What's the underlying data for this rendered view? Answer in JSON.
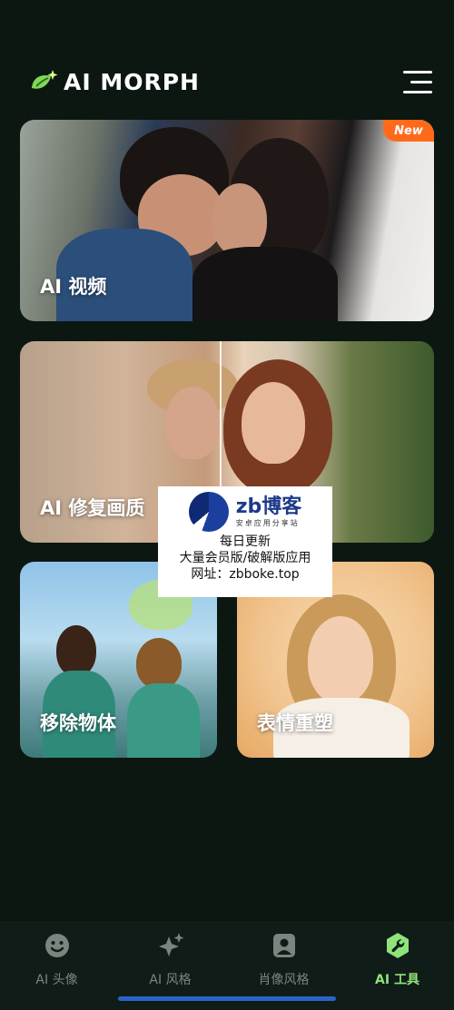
{
  "header": {
    "app_name": "AI MORPH",
    "logo_icon": "leaf-sparkle-logo",
    "menu_icon": "hamburger-menu-icon"
  },
  "cards": [
    {
      "label": "AI 视频",
      "badge": "New"
    },
    {
      "label": "AI 修复画质"
    },
    {
      "label": "移除物体"
    },
    {
      "label": "表情重塑"
    }
  ],
  "watermark": {
    "title": "zb博客",
    "subtitle": "安卓应用分享站",
    "line1": "每日更新",
    "line2": "大量会员版/破解版应用",
    "line3": "网址：zbboke.top"
  },
  "tabbar": {
    "items": [
      {
        "label": "AI 头像",
        "icon": "smiley-face-icon",
        "active": false
      },
      {
        "label": "AI 风格",
        "icon": "sparkle-icon",
        "active": false
      },
      {
        "label": "肖像风格",
        "icon": "portrait-icon",
        "active": false
      },
      {
        "label": "AI 工具",
        "icon": "wrench-icon",
        "active": true
      }
    ]
  },
  "colors": {
    "background": "#0c1712",
    "accent": "#8fe37a",
    "badge": "#ff6a1a",
    "inactive_tab": "#7b857f"
  }
}
